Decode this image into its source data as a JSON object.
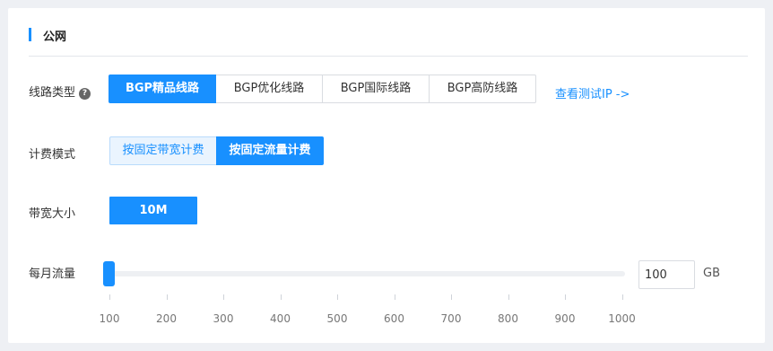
{
  "section": {
    "title": "公网"
  },
  "line_type": {
    "label": "线路类型",
    "help_icon": "question-circle-icon",
    "options": [
      "BGP精品线路",
      "BGP优化线路",
      "BGP国际线路",
      "BGP高防线路"
    ],
    "selected": "BGP精品线路",
    "test_link": "查看测试IP ->"
  },
  "billing": {
    "label": "计费模式",
    "options": [
      "按固定带宽计费",
      "按固定流量计费"
    ],
    "selected": "按固定流量计费"
  },
  "bandwidth": {
    "label": "带宽大小",
    "value": "10M"
  },
  "traffic": {
    "label": "每月流量",
    "ticks": [
      "100",
      "200",
      "300",
      "400",
      "500",
      "600",
      "700",
      "800",
      "900",
      "1000"
    ],
    "min": 100,
    "max": 1000,
    "value": "100",
    "unit": "GB"
  },
  "colors": {
    "accent": "#1890ff",
    "accent_light": "#eaf4fe"
  }
}
